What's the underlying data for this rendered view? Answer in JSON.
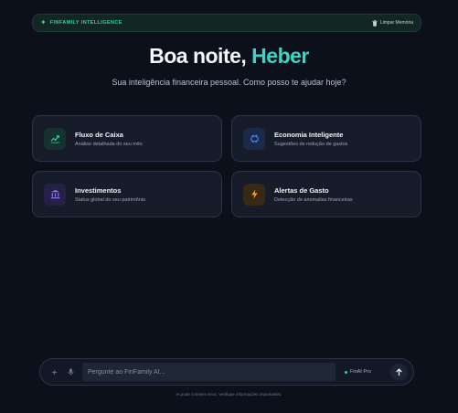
{
  "header": {
    "brand": "FINFAMILY INTELLIGENCE",
    "brand_icon": "sparkle-icon",
    "clear_label": "Limpar Memória",
    "clear_icon": "trash-icon"
  },
  "greeting": {
    "prefix": "Boa noite, ",
    "name": "Heber",
    "subtitle": "Sua inteligência financeira pessoal. Como posso te ajudar hoje?"
  },
  "cards": [
    {
      "title": "Fluxo de Caixa",
      "description": "Análise detalhada do seu mês",
      "icon": "trend-chart-icon",
      "color": "#2fd3a0"
    },
    {
      "title": "Economia Inteligente",
      "description": "Sugestões de redução de gastos",
      "icon": "piggy-bank-icon",
      "color": "#4f83f5"
    },
    {
      "title": "Investimentos",
      "description": "Status global do seu patrimônio",
      "icon": "bank-icon",
      "color": "#8b6cf0"
    },
    {
      "title": "Alertas de Gasto",
      "description": "Detecção de anomalias financeiras",
      "icon": "lightning-icon",
      "color": "#f0a030"
    }
  ],
  "composer": {
    "placeholder": "Pergunte ao FinFamily AI...",
    "value": "",
    "model_label": "FinAI Pro",
    "attach_icon": "sparkle-icon",
    "mic_icon": "microphone-icon",
    "send_icon": "arrow-up-icon"
  },
  "disclaimer": "IA pode cometer erros. Verifique informações importantes.",
  "colors": {
    "background": "#0b101a",
    "accent": "#2fd3a0",
    "name_accent": "#38d6c4"
  }
}
